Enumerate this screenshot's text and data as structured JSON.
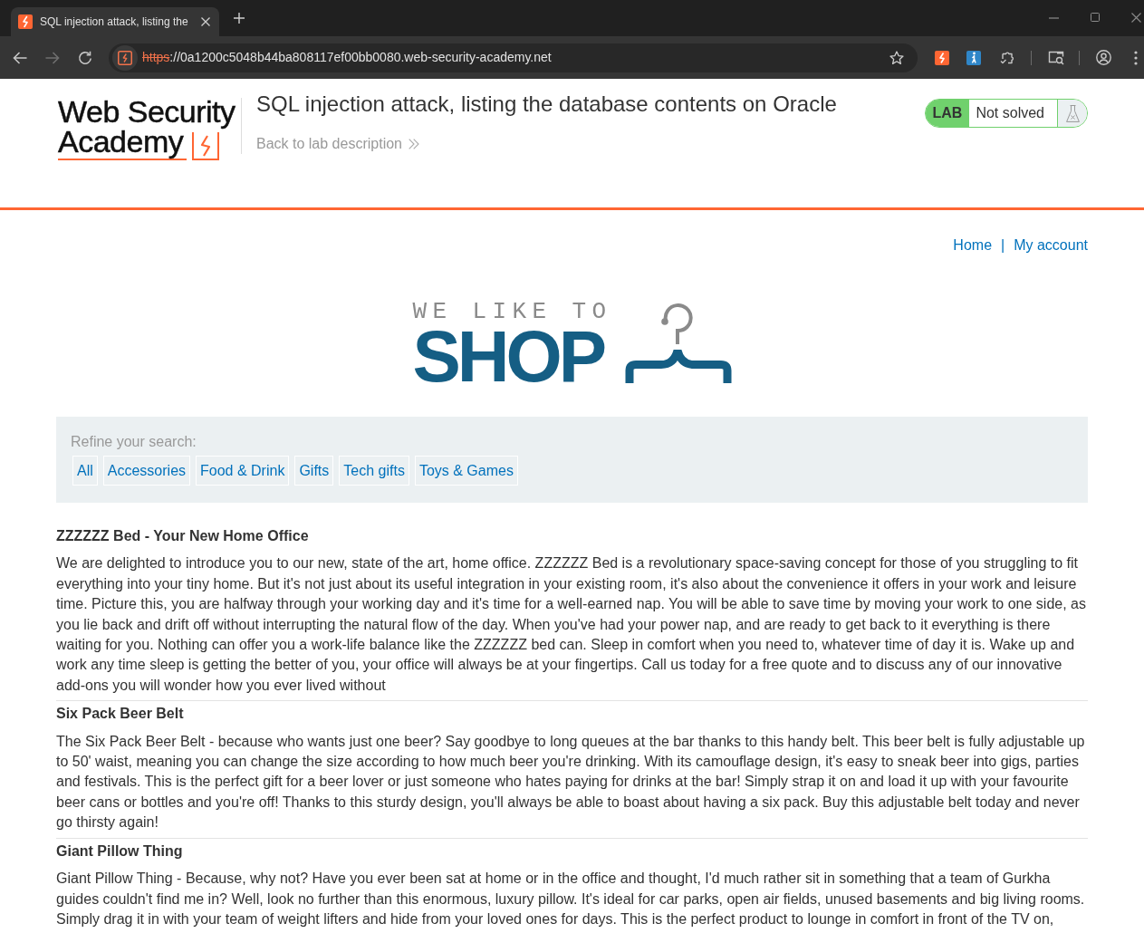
{
  "browser": {
    "tab": {
      "title": "SQL injection attack, listing the"
    },
    "address": {
      "scheme": "https",
      "rest": "://0a1200c5048b44ba808117ef00bb0080.web-security-academy.net",
      "scheme_struck": true
    }
  },
  "header": {
    "logo": [
      "Web Security",
      "Academy"
    ],
    "title": "SQL injection attack, listing the database contents on Oracle",
    "back_link": "Back to lab description",
    "lab_status": {
      "badge": "LAB",
      "text": "Not solved"
    }
  },
  "nav": {
    "links": [
      "Home",
      "My account"
    ],
    "separator": "|"
  },
  "banner": {
    "tagline": "WE LIKE TO",
    "word": "SHOP"
  },
  "filters": {
    "label": "Refine your search:",
    "categories": [
      "All",
      "Accessories",
      "Food & Drink",
      "Gifts",
      "Tech gifts",
      "Toys & Games"
    ]
  },
  "products": [
    {
      "title": "ZZZZZZ Bed - Your New Home Office",
      "description": "We are delighted to introduce you to our new, state of the art, home office. ZZZZZZ Bed is a revolutionary space-saving concept for those of you struggling to fit everything into your tiny home. But it's not just about its useful integration in your existing room, it's also about the convenience it offers in your work and leisure time. Picture this, you are halfway through your working day and it's time for a well-earned nap. You will be able to save time by moving your work to one side, as you lie back and drift off without interrupting the natural flow of the day. When you've had your power nap, and are ready to get back to it everything is there waiting for you. Nothing can offer you a work-life balance like the ZZZZZZ bed can. Sleep in comfort when you need to, whatever time of day it is. Wake up and work any time sleep is getting the better of you, your office will always be at your fingertips. Call us today for a free quote and to discuss any of our innovative add-ons you will wonder how you ever lived without"
    },
    {
      "title": "Six Pack Beer Belt",
      "description": "The Six Pack Beer Belt - because who wants just one beer? Say goodbye to long queues at the bar thanks to this handy belt. This beer belt is fully adjustable up to 50' waist, meaning you can change the size according to how much beer you're drinking. With its camouflage design, it's easy to sneak beer into gigs, parties and festivals. This is the perfect gift for a beer lover or just someone who hates paying for drinks at the bar! Simply strap it on and load it up with your favourite beer cans or bottles and you're off! Thanks to this sturdy design, you'll always be able to boast about having a six pack. Buy this adjustable belt today and never go thirsty again!"
    },
    {
      "title": "Giant Pillow Thing",
      "description": "Giant Pillow Thing - Because, why not? Have you ever been sat at home or in the office and thought, I'd much rather sit in something that a team of Gurkha guides couldn't find me in? Well, look no further than this enormous, luxury pillow. It's ideal for car parks, open air fields, unused basements and big living rooms. Simply drag it in with your team of weight lifters and hide from your loved ones for days. This is the perfect product to lounge in comfort in front of the TV on,"
    }
  ]
}
